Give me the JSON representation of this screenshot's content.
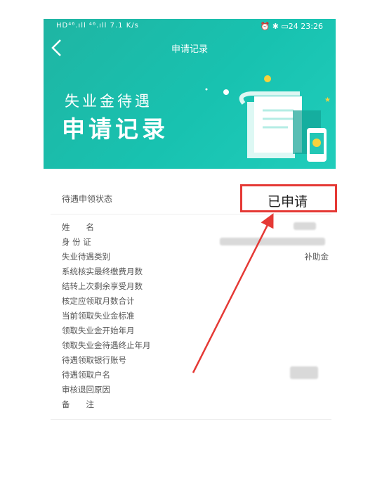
{
  "statusbar": {
    "left": "HD⁴⁶.ıll ⁴⁶.ıll  7.1 K/s",
    "right": "⏰ ✱ ▭24 23:26"
  },
  "nav": {
    "title": "申请记录"
  },
  "banner": {
    "subtitle": "失业金待遇",
    "title": "申请记录"
  },
  "status": {
    "label": "待遇申领状态",
    "value": "已申请"
  },
  "fields": [
    {
      "label": "姓　　名",
      "value": ""
    },
    {
      "label": "身 份 证",
      "value": ""
    },
    {
      "label": "失业待遇类别",
      "value": "补助金"
    },
    {
      "label": "系统核实最终缴费月数",
      "value": ""
    },
    {
      "label": "结转上次剩余享受月数",
      "value": ""
    },
    {
      "label": "核定应领取月数合计",
      "value": ""
    },
    {
      "label": "当前领取失业金标准",
      "value": ""
    },
    {
      "label": "领取失业金开始年月",
      "value": ""
    },
    {
      "label": "领取失业金待遇终止年月",
      "value": ""
    },
    {
      "label": "待遇领取银行账号",
      "value": ""
    },
    {
      "label": "待遇领取户名",
      "value": ""
    },
    {
      "label": "审核退回原因",
      "value": ""
    },
    {
      "label": "备　　注",
      "value": ""
    }
  ],
  "colors": {
    "banner": "#1fb5a3",
    "highlight": "#e53935"
  },
  "icons": [
    "back-arrow-icon",
    "document-illustration-icon",
    "phone-illustration-icon"
  ]
}
